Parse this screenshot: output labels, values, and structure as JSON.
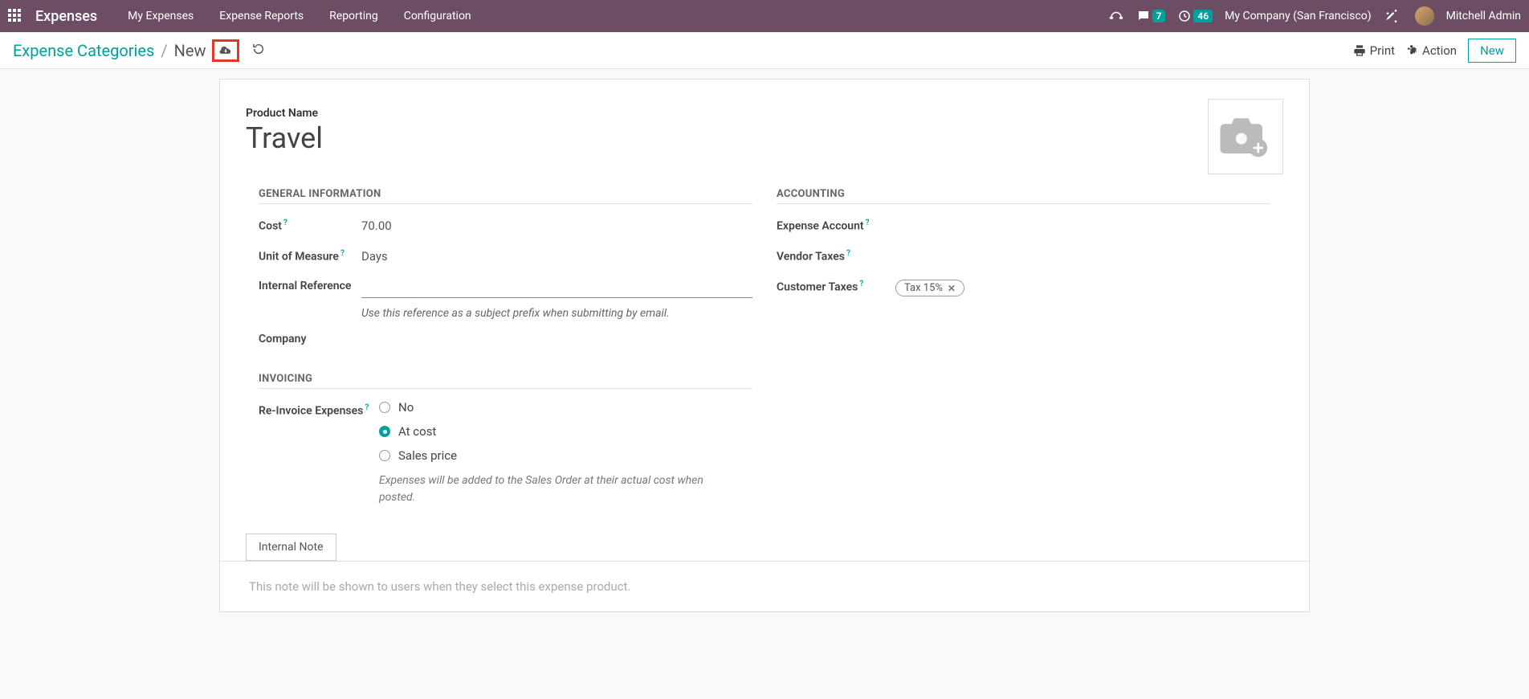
{
  "navbar": {
    "brand": "Expenses",
    "links": [
      "My Expenses",
      "Expense Reports",
      "Reporting",
      "Configuration"
    ],
    "messages_count": "7",
    "activities_count": "46",
    "company": "My Company (San Francisco)",
    "username": "Mitchell Admin"
  },
  "breadcrumb": {
    "parent": "Expense Categories",
    "current": "New"
  },
  "actions": {
    "print": "Print",
    "action": "Action",
    "new": "New"
  },
  "form": {
    "product_name_label": "Product Name",
    "product_name": "Travel",
    "sections": {
      "general": "GENERAL INFORMATION",
      "accounting": "ACCOUNTING",
      "invoicing": "INVOICING"
    },
    "fields": {
      "cost_label": "Cost",
      "cost_value": "70.00",
      "uom_label": "Unit of Measure",
      "uom_value": "Days",
      "internal_ref_label": "Internal Reference",
      "internal_ref_value": "",
      "internal_ref_hint": "Use this reference as a subject prefix when submitting by email.",
      "company_label": "Company",
      "reinvoice_label": "Re-Invoice Expenses",
      "reinvoice_options": {
        "no": "No",
        "at_cost": "At cost",
        "sales_price": "Sales price"
      },
      "reinvoice_selected": "at_cost",
      "reinvoice_hint": "Expenses will be added to the Sales Order at their actual cost when posted.",
      "expense_account_label": "Expense Account",
      "vendor_taxes_label": "Vendor Taxes",
      "customer_taxes_label": "Customer Taxes",
      "customer_taxes_tag": "Tax 15%"
    },
    "tabs": {
      "internal_note": "Internal Note"
    },
    "note_placeholder": "This note will be shown to users when they select this expense product."
  }
}
